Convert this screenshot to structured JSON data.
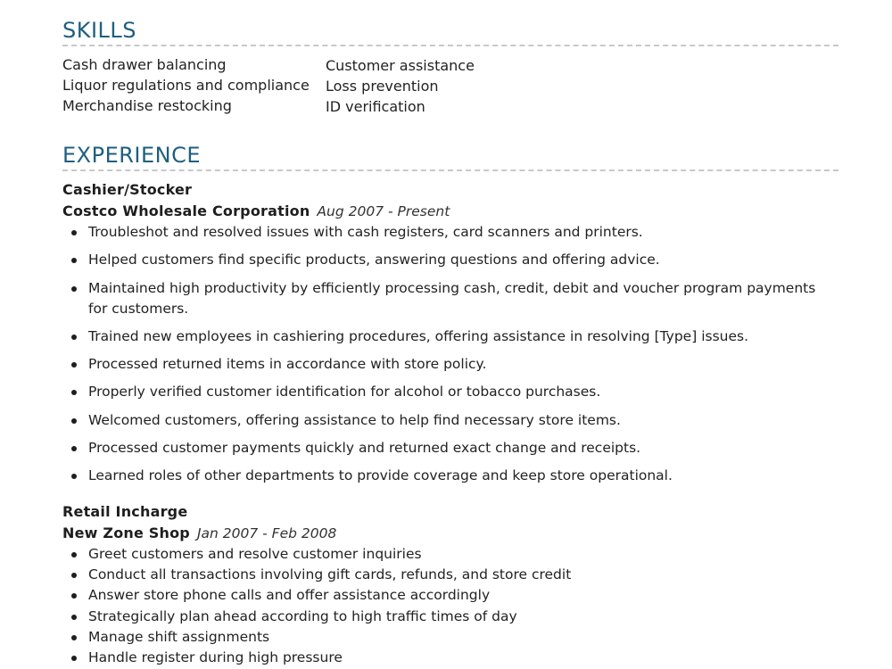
{
  "skills": {
    "heading": "SKILLS",
    "column_left": [
      "Cash drawer balancing",
      "Liquor regulations and compliance",
      "Merchandise restocking"
    ],
    "column_right": [
      "Customer assistance",
      "Loss prevention",
      "ID verification"
    ]
  },
  "experience": {
    "heading": "EXPERIENCE",
    "jobs": [
      {
        "title": "Cashier/Stocker",
        "company": "Costco Wholesale Corporation",
        "dates": "Aug 2007 - Present",
        "bullets": [
          "Troubleshot and resolved issues with cash registers, card scanners and printers.",
          "Helped customers find specific products, answering questions and offering advice.",
          "Maintained high productivity by efficiently processing cash, credit, debit and voucher program payments for customers.",
          "Trained new employees in cashiering procedures, offering assistance in resolving [Type] issues.",
          "Processed returned items in accordance with store policy.",
          "Properly verified customer identification for alcohol or tobacco purchases.",
          "Welcomed customers, offering assistance to help find necessary store items.",
          "Processed customer payments quickly and returned exact change and receipts.",
          "Learned roles of other departments to provide coverage and keep store operational."
        ]
      },
      {
        "title": "Retail Incharge",
        "company": "New Zone Shop",
        "dates": "Jan 2007 - Feb 2008",
        "bullets": [
          "Greet customers and resolve customer inquiries",
          "Conduct all transactions involving gift cards, refunds, and store credit",
          "Answer store phone calls and offer assistance accordingly",
          "Strategically plan ahead according to high traffic times of day",
          "Manage shift assignments",
          "Handle register during high pressure"
        ]
      }
    ]
  },
  "colors": {
    "heading": "#1f5f7f",
    "rule": "#c8c8c8",
    "text": "#222222"
  }
}
